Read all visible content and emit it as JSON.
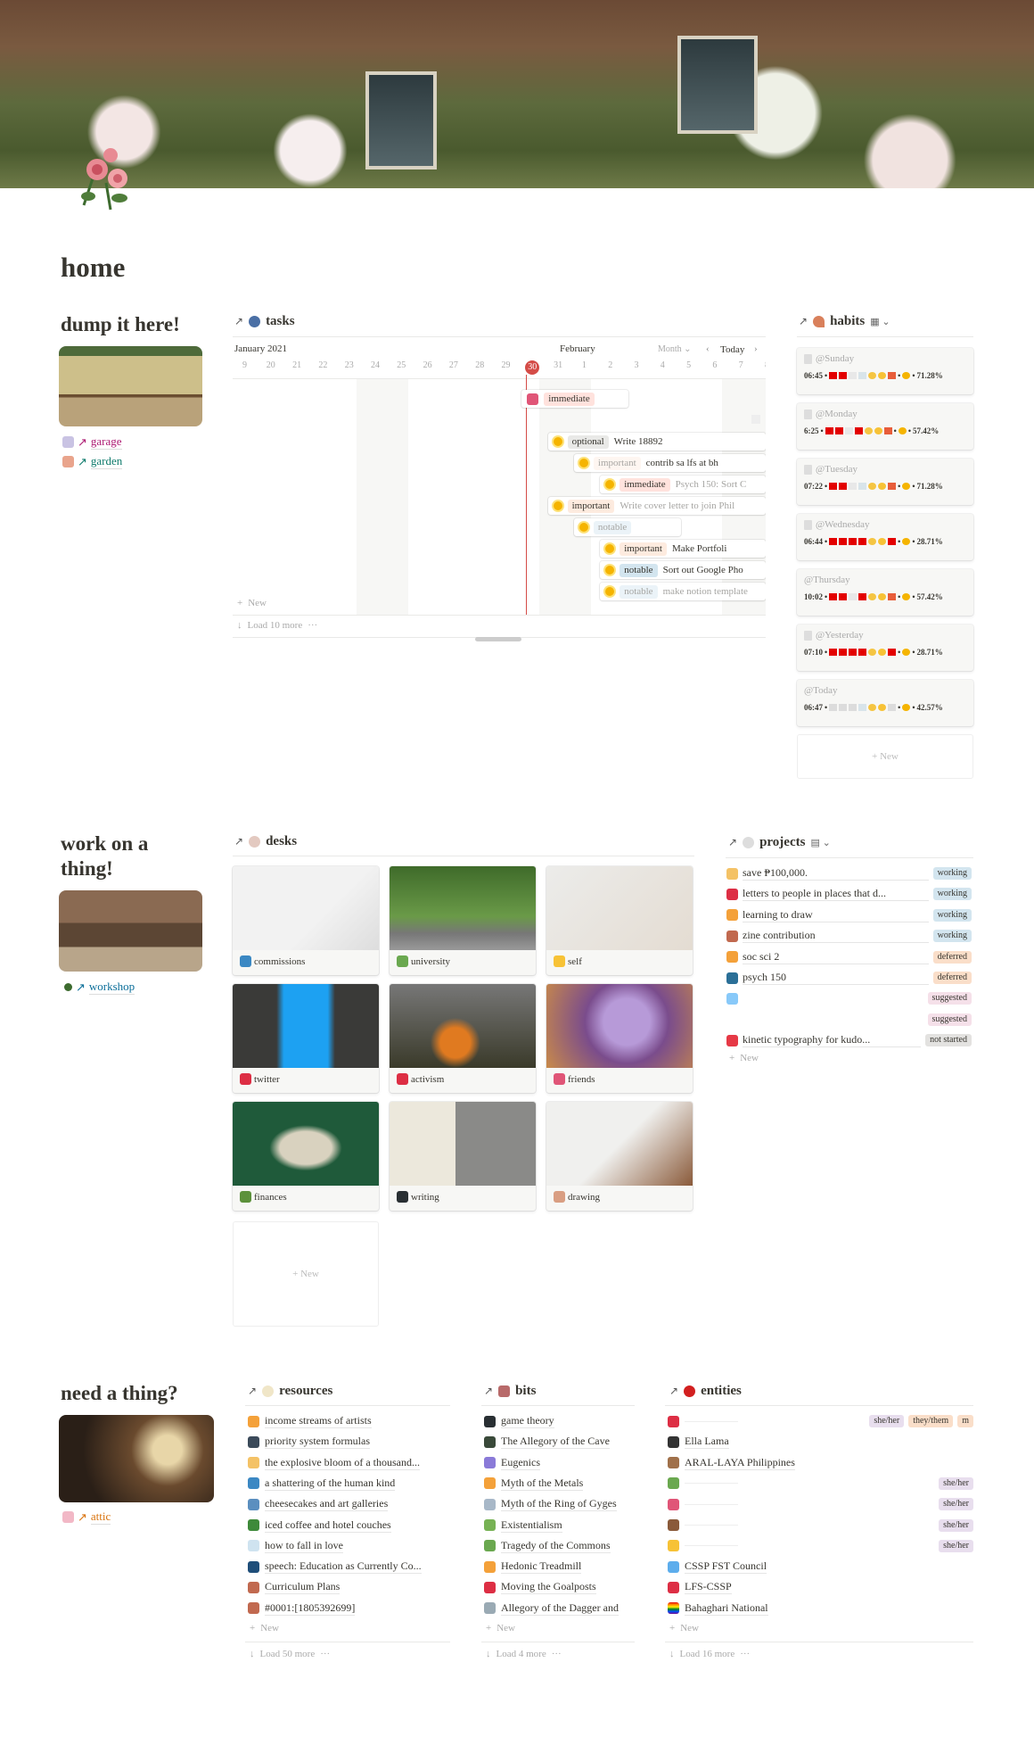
{
  "page": {
    "title": "home"
  },
  "colors": {
    "red_today": "#d44c47",
    "immediate": "#ffe2dd",
    "important": "#fdebdf",
    "optional": "#e9e9e7",
    "notable": "#d3e5ef",
    "working": "#d3e5ef",
    "deferred": "#fadec9",
    "suggested": "#f5e0e9",
    "not_started": "#e3e2e0",
    "she_her": "#e8deee",
    "they_them": "#fadec9",
    "garage": "#ad1a72",
    "garden": "#0f7b6c"
  },
  "dump": {
    "heading": "dump it here!",
    "links": [
      {
        "icon": "lavender-icon",
        "label": "garage"
      },
      {
        "icon": "flowers-icon",
        "label": "garden"
      }
    ]
  },
  "tasks": {
    "title": "tasks",
    "month_left": "January 2021",
    "month_right": "February",
    "view": "Month",
    "today_label": "Today",
    "days": [
      "9",
      "20",
      "21",
      "22",
      "23",
      "24",
      "25",
      "26",
      "27",
      "28",
      "29",
      "30",
      "31",
      "1",
      "2",
      "3",
      "4",
      "5",
      "6",
      "7",
      "8"
    ],
    "today": "30",
    "new_label": "New",
    "load_more": "Load 10 more",
    "rows": [
      {
        "start": "30",
        "icon": "hibiscus-icon",
        "priority": "immediate",
        "name": "",
        "dim": false
      },
      {
        "start": "",
        "icon": "",
        "priority": "",
        "name": "",
        "dim": false
      },
      {
        "start": "31",
        "icon": "sun-icon",
        "priority": "optional",
        "name": "Write 18892",
        "dim": false
      },
      {
        "start": "1",
        "icon": "sun-icon",
        "priority": "important",
        "name": "contrib sa lfs at bh",
        "dim": true
      },
      {
        "start": "2",
        "icon": "sun-icon",
        "priority": "immediate",
        "name": "Psych 150: Sort C",
        "dim": false,
        "name_dim": true
      },
      {
        "start": "31",
        "icon": "sun-icon",
        "priority": "important",
        "name": "Write cover letter to join Phil",
        "dim": false,
        "name_dim": true
      },
      {
        "start": "1",
        "icon": "sun-icon",
        "priority": "notable",
        "name": "",
        "dim": true
      },
      {
        "start": "2",
        "icon": "sun-icon",
        "priority": "important",
        "name": "Make Portfoli",
        "dim": false
      },
      {
        "start": "2",
        "icon": "sun-icon",
        "priority": "notable",
        "name": "Sort out Google Pho",
        "dim": false
      },
      {
        "start": "2",
        "icon": "sun-icon",
        "priority": "notable",
        "name": "make notion template",
        "dim": true,
        "name_dim": true
      }
    ]
  },
  "habits": {
    "title": "habits",
    "new_label": "New",
    "cards": [
      {
        "day": "@Sunday",
        "time": "06:45",
        "marks": [
          "r",
          "r",
          "cup",
          "toilet",
          "moon",
          "star",
          "pill"
        ],
        "mood": "hearts",
        "percent": "71.28%"
      },
      {
        "day": "@Monday",
        "time": "6:25",
        "marks": [
          "r",
          "r",
          "cup",
          "r",
          "moon",
          "star",
          "pill"
        ],
        "mood": "smile",
        "percent": "57.42%"
      },
      {
        "day": "@Tuesday",
        "time": "07:22",
        "marks": [
          "r",
          "r",
          "cup",
          "toilet",
          "moon",
          "star",
          "pill"
        ],
        "mood": "smile",
        "percent": "71.28%"
      },
      {
        "day": "@Wednesday",
        "time": "06:44",
        "marks": [
          "r",
          "r",
          "r",
          "r",
          "moon",
          "star",
          "r"
        ],
        "mood": "smile",
        "percent": "28.71%"
      },
      {
        "day": "@Thursday",
        "time": "10:02",
        "marks": [
          "r",
          "r",
          "cup",
          "r",
          "moon",
          "star",
          "pill"
        ],
        "mood": "hearts",
        "percent": "57.42%"
      },
      {
        "day": "@Yesterday",
        "time": "07:10",
        "marks": [
          "r",
          "r",
          "r",
          "r",
          "moon",
          "star",
          "r"
        ],
        "mood": "smile",
        "percent": "28.71%"
      },
      {
        "day": "@Today",
        "time": "06:47",
        "marks": [
          "g",
          "g",
          "g",
          "toilet",
          "moon",
          "star",
          "g"
        ],
        "mood": "neutral",
        "percent": "42.57%"
      }
    ]
  },
  "work": {
    "heading": "work on a thing!",
    "link": "workshop"
  },
  "desks": {
    "title": "desks",
    "new_label": "New",
    "cards": [
      {
        "label": "commissions",
        "icon": "paintbrush-icon"
      },
      {
        "label": "university",
        "icon": "herb-icon"
      },
      {
        "label": "self",
        "icon": "yellow-heart-icon"
      },
      {
        "label": "twitter",
        "icon": "bird-icon"
      },
      {
        "label": "activism",
        "icon": "flag-icon"
      },
      {
        "label": "friends",
        "icon": "two-hearts-icon"
      },
      {
        "label": "finances",
        "icon": "money-icon"
      },
      {
        "label": "writing",
        "icon": "pen-icon"
      },
      {
        "label": "drawing",
        "icon": "palette-icon"
      }
    ]
  },
  "projects": {
    "title": "projects",
    "new_label": "New",
    "rows": [
      {
        "icon": "money-bag-icon",
        "name": "save ₱100,000.",
        "status": "working"
      },
      {
        "icon": "love-letter-icon",
        "name": "letters to people in places that d...",
        "status": "working"
      },
      {
        "icon": "pencil-icon",
        "name": "learning to draw",
        "status": "working"
      },
      {
        "icon": "outbox-icon",
        "name": "zine contribution",
        "status": "working"
      },
      {
        "icon": "scales-icon",
        "name": "soc sci 2",
        "status": "deferred"
      },
      {
        "icon": "people-icon",
        "name": "psych 150",
        "status": "deferred"
      },
      {
        "icon": "satellite-icon",
        "name": "",
        "status": "suggested"
      },
      {
        "icon": "",
        "name": "",
        "status": "suggested"
      },
      {
        "icon": "explosion-icon",
        "name": "kinetic typography for kudo...",
        "status": "not started"
      }
    ]
  },
  "needs": {
    "heading": "need a thing?",
    "link": "attic"
  },
  "resources": {
    "title": "resources",
    "new_label": "New",
    "load_more": "Load 50 more",
    "items": [
      "income streams of artists",
      "priority system formulas",
      "the explosive bloom of a thousand...",
      "a shattering of the human kind",
      "cheesecakes and art galleries",
      "iced coffee and hotel couches",
      "how to fall in love",
      "speech: Education as Currently Co...",
      "Curriculum Plans",
      "#0001:[1805392699]"
    ]
  },
  "bits": {
    "title": "bits",
    "new_label": "New",
    "load_more": "Load 4 more",
    "items": [
      "game theory",
      "The Allegory of the Cave",
      "Eugenics",
      "Myth of the Metals",
      "Myth of the Ring of Gyges",
      "Existentialism",
      "Tragedy of the Commons",
      "Hedonic Treadmill",
      "Moving the Goalposts",
      "Allegory of the Dagger and"
    ]
  },
  "entities": {
    "title": "entities",
    "new_label": "New",
    "load_more": "Load 16 more",
    "items": [
      {
        "icon": "die-icon",
        "name": "",
        "pronouns": [
          "she/her",
          "they/them",
          "m"
        ]
      },
      {
        "icon": "person-icon",
        "name": "Ella Lama",
        "pronouns": []
      },
      {
        "icon": "peace-hand-icon",
        "name": "ARAL-LAYA Philippines",
        "pronouns": []
      },
      {
        "icon": "herb-icon",
        "name": "",
        "pronouns": [
          "she/her"
        ]
      },
      {
        "icon": "hibiscus-icon",
        "name": "",
        "pronouns": [
          "she/her"
        ]
      },
      {
        "icon": "coffee-icon",
        "name": "",
        "pronouns": [
          "she/her"
        ]
      },
      {
        "icon": "yellow-heart-icon",
        "name": "",
        "pronouns": [
          "she/her"
        ]
      },
      {
        "icon": "blue-heart-icon",
        "name": "CSSP FST Council",
        "pronouns": []
      },
      {
        "icon": "red-flag-icon",
        "name": "LFS-CSSP",
        "pronouns": []
      },
      {
        "icon": "rainbow-flag-icon",
        "name": "Bahaghari National",
        "pronouns": []
      }
    ]
  }
}
